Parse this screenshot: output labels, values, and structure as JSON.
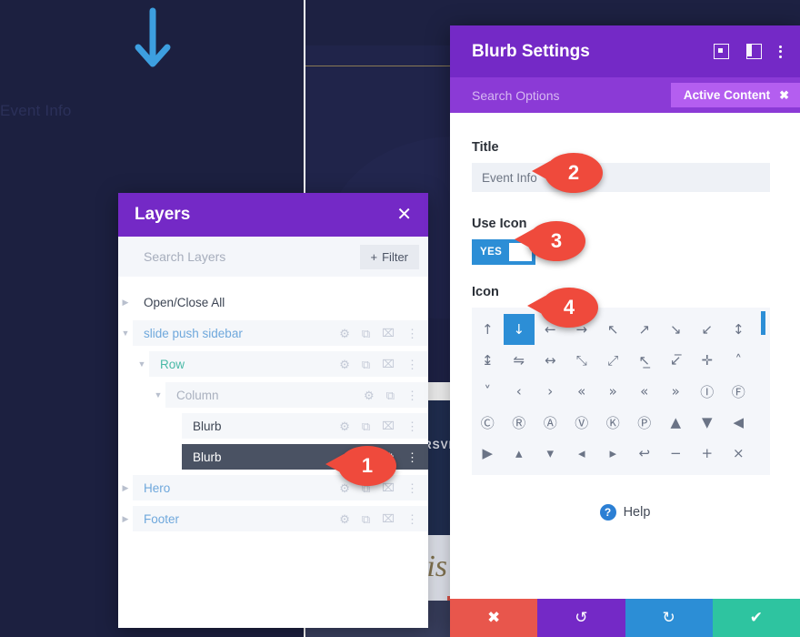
{
  "background": {
    "blurb_title": "Event Info",
    "arrow_icon": "arrow-down-icon",
    "arrow_color": "#3d9fe0",
    "rsvp_text": "RSVP",
    "script_text": ";is"
  },
  "layers_panel": {
    "title": "Layers",
    "close_icon": "close-icon",
    "search": {
      "placeholder": "Search Layers",
      "value": ""
    },
    "filter_button": {
      "label": "Filter",
      "icon": "plus-icon"
    },
    "open_close_all": "Open/Close All",
    "row_actions": {
      "settings": "gear-icon",
      "duplicate": "duplicate-icon",
      "delete": "trash-icon",
      "more": "kebab-menu-icon"
    },
    "rows": [
      {
        "label": "slide push sidebar",
        "indent": 0,
        "color": "blue",
        "twisty": "open",
        "actions": [
          "gear",
          "duplicate",
          "trash",
          "kebab"
        ],
        "selected": false
      },
      {
        "label": "Row",
        "indent": 1,
        "color": "teal",
        "twisty": "open",
        "actions": [
          "gear",
          "duplicate",
          "trash",
          "kebab"
        ],
        "selected": false
      },
      {
        "label": "Column",
        "indent": 2,
        "color": "gray",
        "twisty": "open",
        "actions": [
          "gear",
          "duplicate",
          "kebab"
        ],
        "selected": false
      },
      {
        "label": "Blurb",
        "indent": 3,
        "color": "dark",
        "twisty": "none",
        "actions": [
          "gear",
          "duplicate",
          "trash",
          "kebab"
        ],
        "selected": false
      },
      {
        "label": "Blurb",
        "indent": 3,
        "color": "dark",
        "twisty": "none",
        "actions": [
          "gear",
          "kebab"
        ],
        "selected": true
      },
      {
        "label": "Hero",
        "indent": 0,
        "color": "blue",
        "twisty": "closed",
        "actions": [
          "gear",
          "duplicate",
          "trash",
          "kebab"
        ],
        "selected": false
      },
      {
        "label": "Footer",
        "indent": 0,
        "color": "blue",
        "twisty": "closed",
        "actions": [
          "gear",
          "duplicate",
          "trash",
          "kebab"
        ],
        "selected": false
      }
    ]
  },
  "settings_modal": {
    "title": "Blurb Settings",
    "header_icons": [
      "target-icon",
      "panel-layout-icon",
      "kebab-menu-icon"
    ],
    "search_options_placeholder": "Search Options",
    "active_content_badge": {
      "label": "Active Content",
      "close_icon": "close-icon"
    },
    "fields": {
      "title_label": "Title",
      "title_value": "Event Info",
      "use_icon_label": "Use Icon",
      "toggle_value": "YES",
      "icon_label": "Icon"
    },
    "icon_grid": {
      "selected_index": 1,
      "rows": [
        [
          "↑",
          "↓",
          "←",
          "→",
          "↖",
          "↗",
          "↘",
          "↙",
          "↕"
        ],
        [
          "↨",
          "⇋",
          "↔",
          "⤡",
          "⤢",
          "↖̲",
          "↙̅",
          "✛",
          "˄"
        ],
        [
          "˅",
          "‹",
          "›",
          "«",
          "»",
          "«",
          "»",
          "Ⓘ",
          "Ⓕ"
        ],
        [
          "Ⓒ",
          "Ⓡ",
          "Ⓐ",
          "Ⓥ",
          "Ⓚ",
          "Ⓟ",
          "▲",
          "▼",
          "◀"
        ],
        [
          "▶",
          "▴",
          "▾",
          "◂",
          "▸",
          "↩",
          "−",
          "+",
          "×"
        ]
      ]
    },
    "help": {
      "label": "Help",
      "icon": "question-circle-icon"
    },
    "footer_buttons": [
      {
        "name": "cancel",
        "glyph": "✖",
        "color": "#e8564c"
      },
      {
        "name": "undo",
        "glyph": "↺",
        "color": "#7429c6"
      },
      {
        "name": "redo",
        "glyph": "↻",
        "color": "#2c8ed6"
      },
      {
        "name": "save",
        "glyph": "✔",
        "color": "#2ec4a0"
      }
    ]
  },
  "callouts": [
    {
      "number": "1"
    },
    {
      "number": "2"
    },
    {
      "number": "3"
    },
    {
      "number": "4"
    }
  ],
  "colors": {
    "brand_purple": "#7429c6",
    "sub_purple": "#8b3ad6",
    "badge_purple": "#b45ef0",
    "accent_blue": "#2c8ed6",
    "callout_red": "#ef4a3c",
    "page_dark": "#1c2040"
  }
}
